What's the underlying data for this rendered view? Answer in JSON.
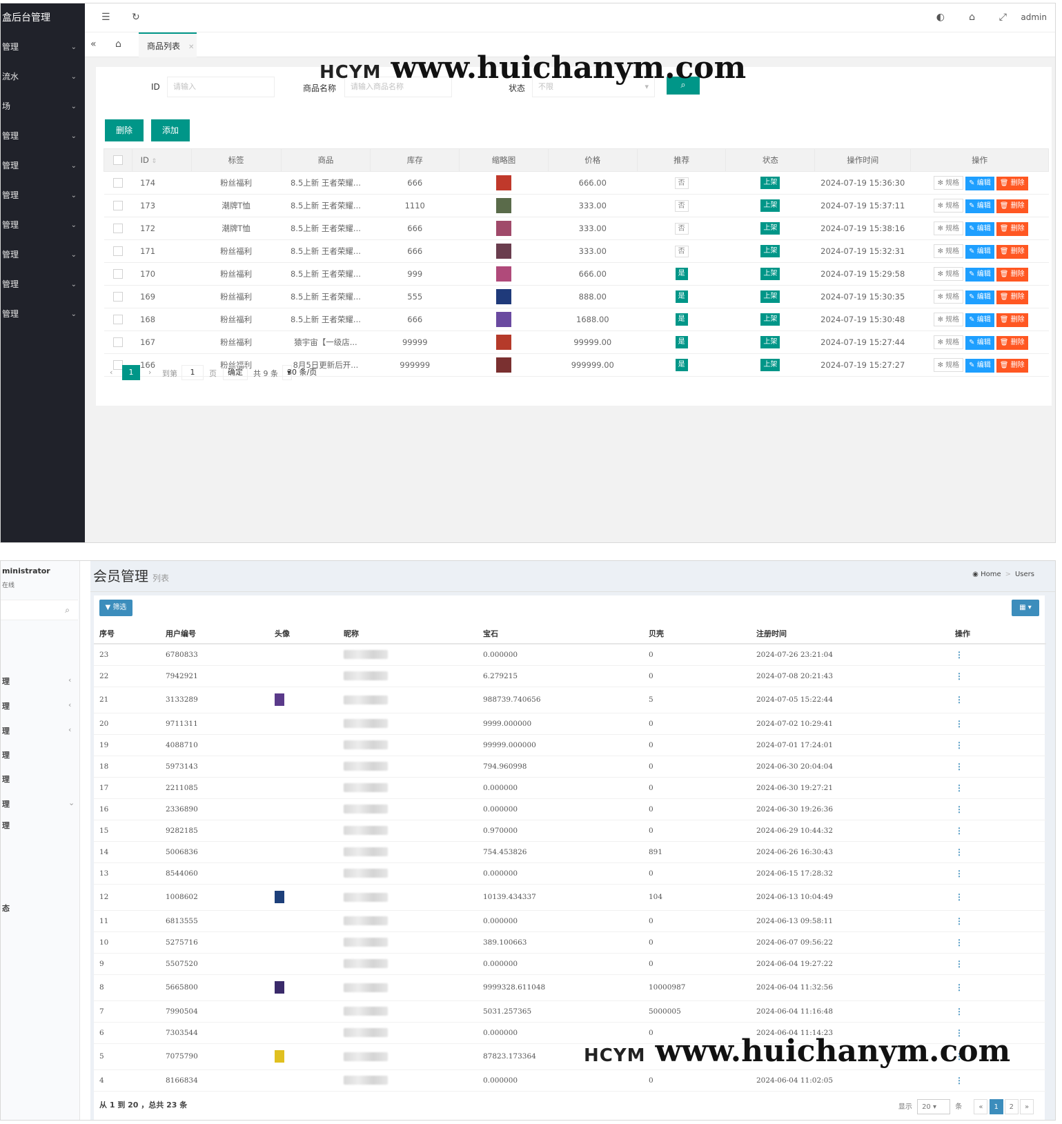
{
  "top": {
    "brand": "盒后台管理",
    "admin": "admin",
    "sidebar": [
      {
        "label": "管理"
      },
      {
        "label": "流水"
      },
      {
        "label": "场"
      },
      {
        "label": "管理"
      },
      {
        "label": "管理"
      },
      {
        "label": "管理"
      },
      {
        "label": "管理"
      },
      {
        "label": "管理"
      },
      {
        "label": "管理"
      },
      {
        "label": "管理"
      }
    ],
    "tab_label": "商品列表",
    "search": {
      "id_label": "ID",
      "id_placeholder": "请输入",
      "name_label": "商品名称",
      "name_placeholder": "请输入商品名称",
      "status_label": "状态",
      "status_value": "不限"
    },
    "buttons": {
      "delete": "删除",
      "add": "添加"
    },
    "columns": [
      "ID",
      "标签",
      "商品",
      "库存",
      "缩略图",
      "价格",
      "推荐",
      "状态",
      "操作时间",
      "操作"
    ],
    "rows": [
      {
        "id": "174",
        "tag": "粉丝福利",
        "goods": "8.5上新 王者荣耀...",
        "stock": "666",
        "price": "666.00",
        "rec": "否",
        "status": "上架",
        "time": "2024-07-19 15:36:30",
        "thumb": "#c0392b"
      },
      {
        "id": "173",
        "tag": "潮牌T恤",
        "goods": "8.5上新 王者荣耀...",
        "stock": "1110",
        "price": "333.00",
        "rec": "否",
        "status": "上架",
        "time": "2024-07-19 15:37:11",
        "thumb": "#5a6b4a"
      },
      {
        "id": "172",
        "tag": "潮牌T恤",
        "goods": "8.5上新 王者荣耀...",
        "stock": "666",
        "price": "333.00",
        "rec": "否",
        "status": "上架",
        "time": "2024-07-19 15:38:16",
        "thumb": "#a04a6a"
      },
      {
        "id": "171",
        "tag": "粉丝福利",
        "goods": "8.5上新 王者荣耀...",
        "stock": "666",
        "price": "333.00",
        "rec": "否",
        "status": "上架",
        "time": "2024-07-19 15:32:31",
        "thumb": "#6a3d4e"
      },
      {
        "id": "170",
        "tag": "粉丝福利",
        "goods": "8.5上新 王者荣耀...",
        "stock": "999",
        "price": "666.00",
        "rec": "是",
        "status": "上架",
        "time": "2024-07-19 15:29:58",
        "thumb": "#b04a7a"
      },
      {
        "id": "169",
        "tag": "粉丝福利",
        "goods": "8.5上新 王者荣耀...",
        "stock": "555",
        "price": "888.00",
        "rec": "是",
        "status": "上架",
        "time": "2024-07-19 15:30:35",
        "thumb": "#1f3a7a"
      },
      {
        "id": "168",
        "tag": "粉丝福利",
        "goods": "8.5上新 王者荣耀...",
        "stock": "666",
        "price": "1688.00",
        "rec": "是",
        "status": "上架",
        "time": "2024-07-19 15:30:48",
        "thumb": "#6a4aa0"
      },
      {
        "id": "167",
        "tag": "粉丝福利",
        "goods": "猿宇宙【一级店...",
        "stock": "99999",
        "price": "99999.00",
        "rec": "是",
        "status": "上架",
        "time": "2024-07-19 15:27:44",
        "thumb": "#b53a2a"
      },
      {
        "id": "166",
        "tag": "粉丝福利",
        "goods": "8月5日更新后开...",
        "stock": "999999",
        "price": "999999.00",
        "rec": "是",
        "status": "上架",
        "time": "2024-07-19 15:27:27",
        "thumb": "#7a3030"
      }
    ],
    "ops": {
      "spec": "规格",
      "edit": "编辑",
      "del": "删除"
    },
    "pager": {
      "current": "1",
      "goto": "到第",
      "page_input": "1",
      "page_unit": "页",
      "confirm": "确定",
      "total": "共 9 条",
      "per_page": "30 条/页"
    }
  },
  "watermark": {
    "logo": "HCYM",
    "url": "www.huichanym.com"
  },
  "bottom": {
    "user": "ministrator",
    "status": "在线",
    "side_items": [
      "理",
      "理",
      "理",
      "理",
      "理",
      "理",
      "理",
      "态"
    ],
    "title": "会员管理",
    "subtitle": "列表",
    "crumb_home": "Home",
    "crumb_users": "Users",
    "filter_label": "筛选",
    "columns": [
      "序号",
      "用户编号",
      "头像",
      "昵称",
      "宝石",
      "贝壳",
      "注册时间",
      "操作"
    ],
    "rows": [
      {
        "no": "23",
        "uid": "6780833",
        "avatar": "",
        "gem": "0.000000",
        "shell": "0",
        "time": "2024-07-26 23:21:04"
      },
      {
        "no": "22",
        "uid": "7942921",
        "avatar": "",
        "gem": "6.279215",
        "shell": "0",
        "time": "2024-07-08 20:21:43"
      },
      {
        "no": "21",
        "uid": "3133289",
        "avatar": "#5a3a8a",
        "gem": "988739.740656",
        "shell": "5",
        "time": "2024-07-05 15:22:44"
      },
      {
        "no": "20",
        "uid": "9711311",
        "avatar": "",
        "gem": "9999.000000",
        "shell": "0",
        "time": "2024-07-02 10:29:41"
      },
      {
        "no": "19",
        "uid": "4088710",
        "avatar": "",
        "gem": "99999.000000",
        "shell": "0",
        "time": "2024-07-01 17:24:01"
      },
      {
        "no": "18",
        "uid": "5973143",
        "avatar": "",
        "gem": "794.960998",
        "shell": "0",
        "time": "2024-06-30 20:04:04"
      },
      {
        "no": "17",
        "uid": "2211085",
        "avatar": "",
        "gem": "0.000000",
        "shell": "0",
        "time": "2024-06-30 19:27:21"
      },
      {
        "no": "16",
        "uid": "2336890",
        "avatar": "",
        "gem": "0.000000",
        "shell": "0",
        "time": "2024-06-30 19:26:36"
      },
      {
        "no": "15",
        "uid": "9282185",
        "avatar": "",
        "gem": "0.970000",
        "shell": "0",
        "time": "2024-06-29 10:44:32"
      },
      {
        "no": "14",
        "uid": "5006836",
        "avatar": "",
        "gem": "754.453826",
        "shell": "891",
        "time": "2024-06-26 16:30:43"
      },
      {
        "no": "13",
        "uid": "8544060",
        "avatar": "",
        "gem": "0.000000",
        "shell": "0",
        "time": "2024-06-15 17:28:32"
      },
      {
        "no": "12",
        "uid": "1008602",
        "avatar": "#1d3f7a",
        "gem": "10139.434337",
        "shell": "104",
        "time": "2024-06-13 10:04:49"
      },
      {
        "no": "11",
        "uid": "6813555",
        "avatar": "",
        "gem": "0.000000",
        "shell": "0",
        "time": "2024-06-13 09:58:11"
      },
      {
        "no": "10",
        "uid": "5275716",
        "avatar": "",
        "gem": "389.100663",
        "shell": "0",
        "time": "2024-06-07 09:56:22"
      },
      {
        "no": "9",
        "uid": "5507520",
        "avatar": "",
        "gem": "0.000000",
        "shell": "0",
        "time": "2024-06-04 19:27:22"
      },
      {
        "no": "8",
        "uid": "5665800",
        "avatar": "#3a2a6a",
        "gem": "9999328.611048",
        "shell": "10000987",
        "time": "2024-06-04 11:32:56"
      },
      {
        "no": "7",
        "uid": "7990504",
        "avatar": "",
        "gem": "5031.257365",
        "shell": "5000005",
        "time": "2024-06-04 11:16:48"
      },
      {
        "no": "6",
        "uid": "7303544",
        "avatar": "",
        "gem": "0.000000",
        "shell": "0",
        "time": "2024-06-04 11:14:23"
      },
      {
        "no": "5",
        "uid": "7075790",
        "avatar": "#e0c020",
        "gem": "87823.173364",
        "shell": "",
        "time": ""
      },
      {
        "no": "4",
        "uid": "8166834",
        "avatar": "",
        "gem": "0.000000",
        "shell": "0",
        "time": "2024-06-04 11:02:05"
      }
    ],
    "footer": "从 1 到 20 ，总共 23 条",
    "pager": {
      "show": "显示",
      "per": "20",
      "unit": "条",
      "prev": "«",
      "p1": "1",
      "p2": "2",
      "next": "»"
    }
  }
}
